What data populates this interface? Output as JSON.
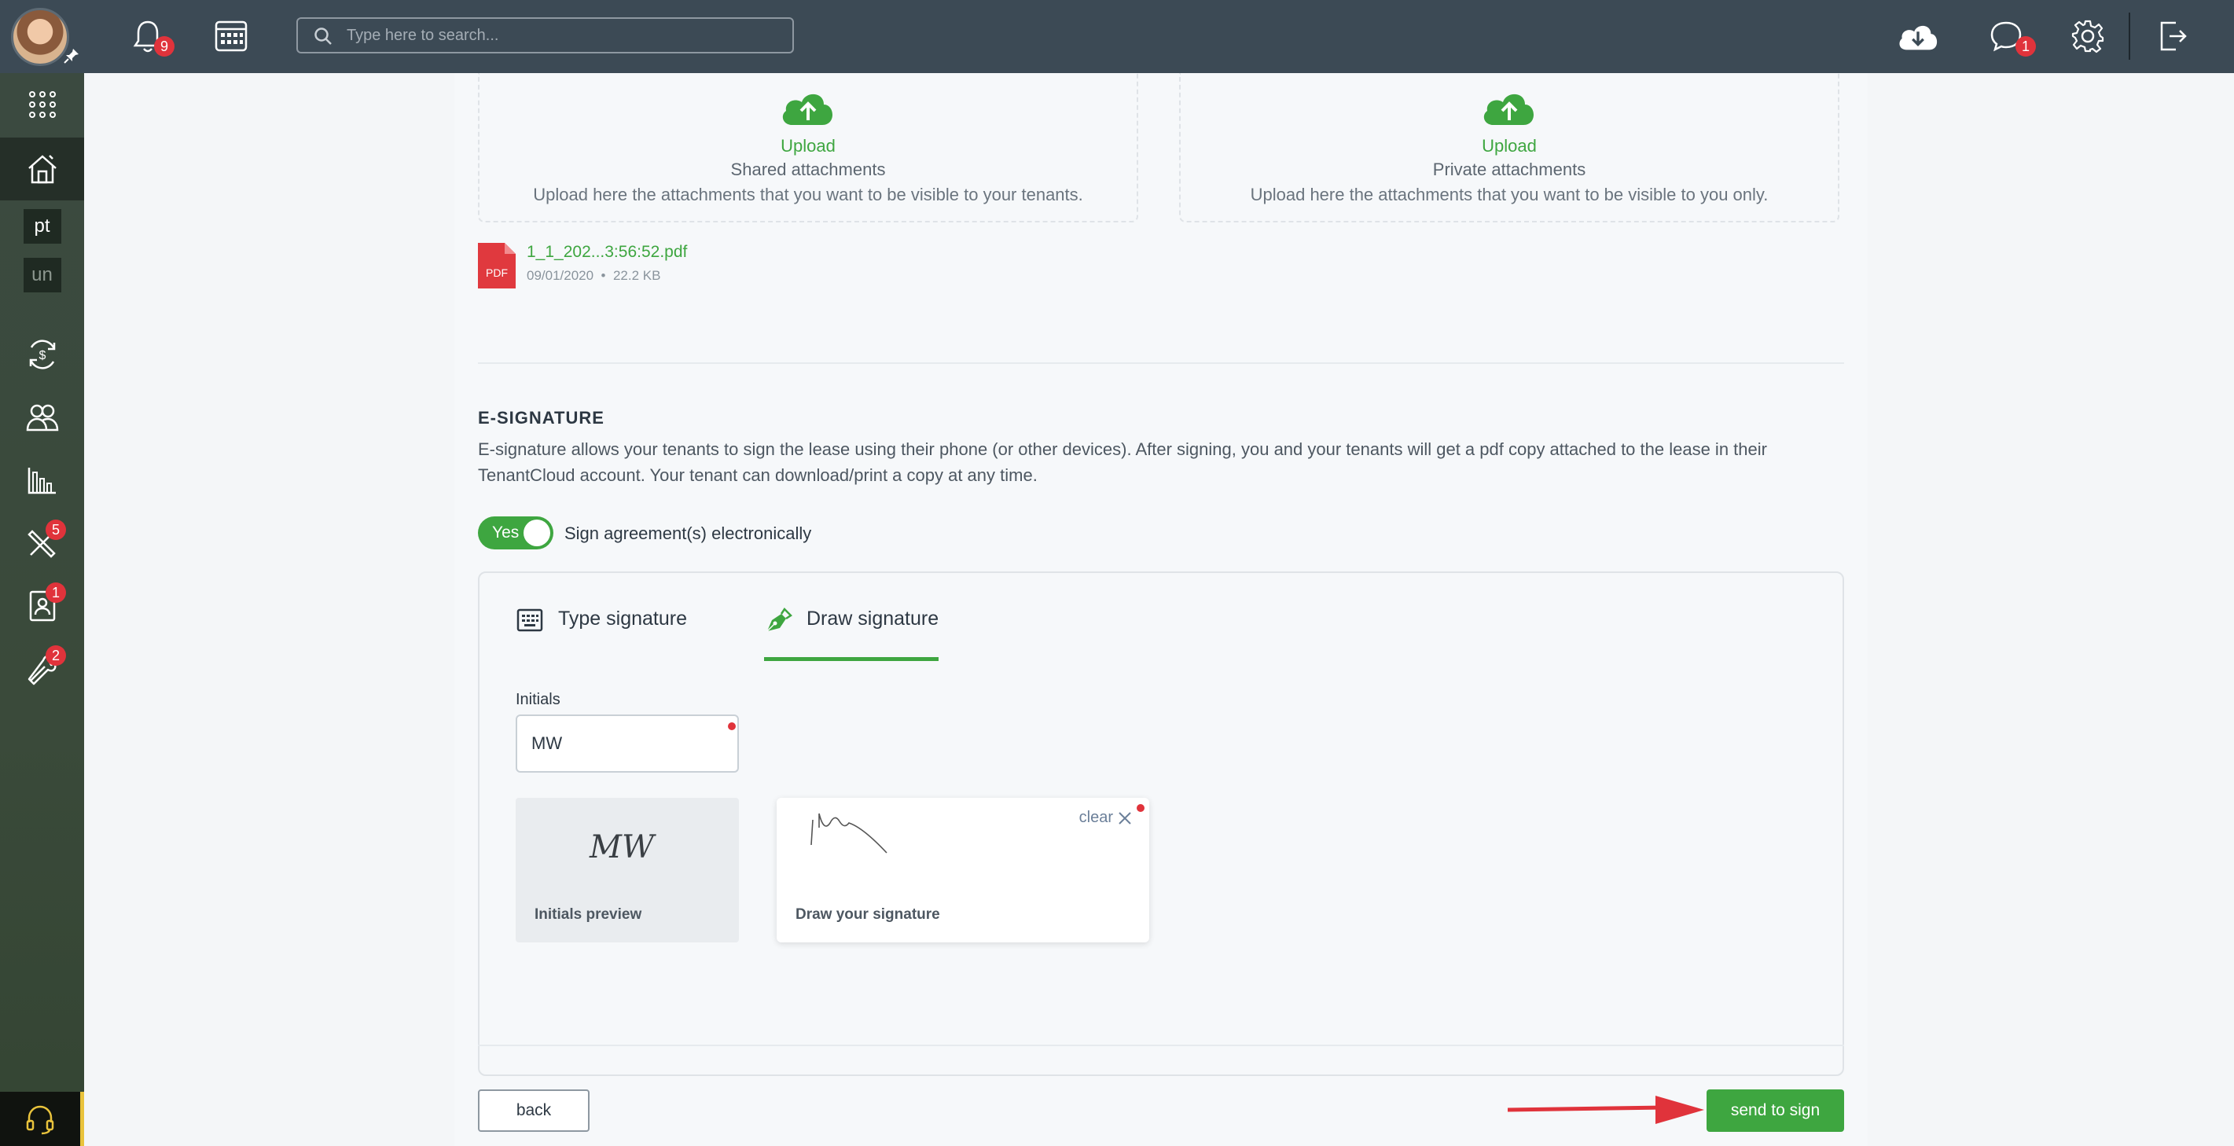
{
  "topbar": {
    "notifications_count": "9",
    "search_placeholder": "Type here to search...",
    "messages_count": "1"
  },
  "sidebar": {
    "items": [
      {
        "label": "pt"
      },
      {
        "label": "un"
      }
    ],
    "badges": {
      "maintenance": "5",
      "applications": "1",
      "tools": "2"
    }
  },
  "attachments": {
    "shared": {
      "action": "Upload",
      "title": "Shared attachments",
      "description": "Upload here the attachments that you want to be visible to your tenants."
    },
    "private": {
      "action": "Upload",
      "title": "Private attachments",
      "description": "Upload here the attachments that you want to be visible to you only."
    },
    "file": {
      "type": "PDF",
      "name": "1_1_202...3:56:52.pdf",
      "date": "09/01/2020",
      "separator": "•",
      "size": "22.2 KB"
    }
  },
  "esignature": {
    "title": "E-SIGNATURE",
    "description": "E-signature allows your tenants to sign the lease using their phone (or other devices). After signing, you and your tenants will get a pdf copy attached to the lease in their TenantCloud account. Your tenant can download/print a copy at any time.",
    "toggle_label": "Yes",
    "toggle_on": true,
    "toggle_text": "Sign agreement(s) electronically",
    "tabs": [
      {
        "label": "Type signature",
        "active": false
      },
      {
        "label": "Draw signature",
        "active": true
      }
    ],
    "initials_label": "Initials",
    "initials_value": "MW",
    "initials_preview_text": "MW",
    "initials_preview_label": "Initials preview",
    "draw_label": "Draw your signature",
    "clear_label": "clear"
  },
  "footer": {
    "back_label": "back",
    "send_label": "send to sign"
  },
  "colors": {
    "accent": "#3ea640",
    "badge": "#e0333b",
    "topbar": "#3c4a55"
  }
}
